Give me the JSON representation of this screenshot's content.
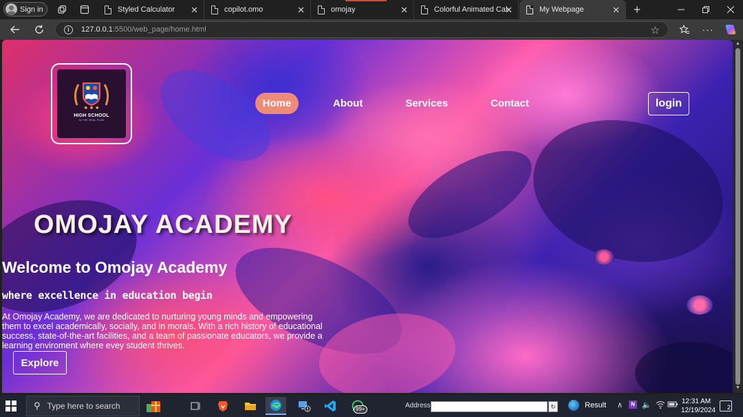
{
  "browser": {
    "signin_label": "Sign in",
    "tabs": [
      {
        "label": "Styled Calculator"
      },
      {
        "label": "copilot.omo"
      },
      {
        "label": "omojay"
      },
      {
        "label": "Colorful Animated Calcul"
      },
      {
        "label": "My Webpage"
      }
    ],
    "url_host": "127.0.0.1",
    "url_rest": ":5500/web_page/home.html"
  },
  "site": {
    "logo": {
      "title": "HIGH SCHOOL",
      "subtitle": "IN THE REAL PLAN"
    },
    "nav": [
      {
        "label": "Home",
        "active": true
      },
      {
        "label": "About"
      },
      {
        "label": "Services"
      },
      {
        "label": "Contact"
      }
    ],
    "login_label": "login",
    "headline": "OMOJAY ACADEMY",
    "welcome": "Welcome to Omojay Academy",
    "tagline": "where excellence in education begin",
    "about": "At Omojay Academy, we are dedicated to nurturing young minds and empowering them to excel academically, socially, and in morals. With a rich history of educational success, state-of-the-art facilities, and a team of passionate educators, we provide a learning enviroment where evey student thrives.",
    "explore_label": "Explore",
    "colors": {
      "active_nav": "#f08a78",
      "logo_bg": "#2a1030"
    }
  },
  "taskbar": {
    "search_placeholder": "Type here to search",
    "address_label": "Address",
    "result_label": "Result",
    "badge": "99+",
    "time": "12:31 AM",
    "date": "12/19/2024",
    "notification_count": "2"
  }
}
